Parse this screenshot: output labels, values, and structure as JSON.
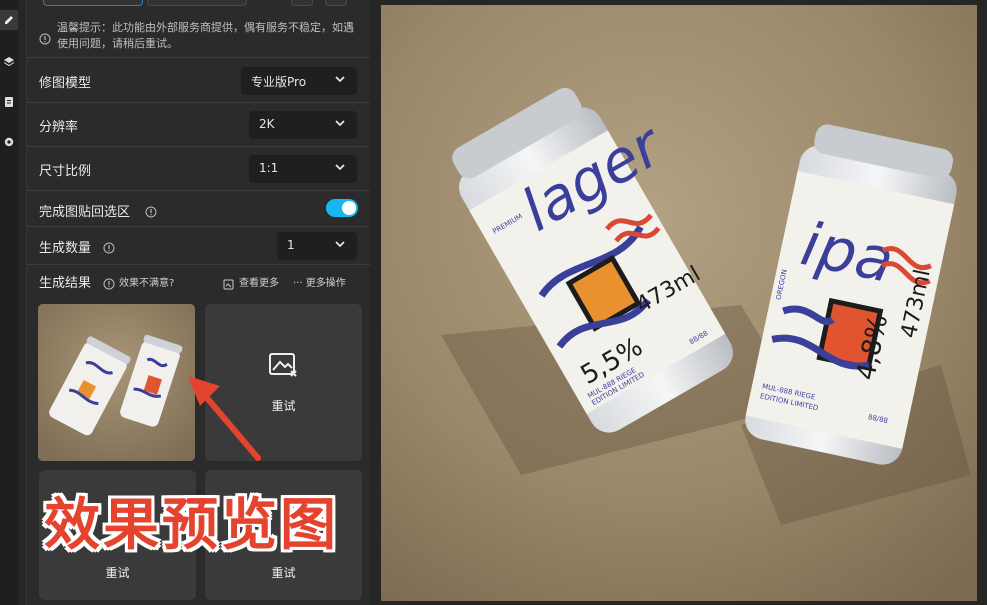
{
  "notice": {
    "text": "温馨提示：此功能由外部服务商提供，偶有服务不稳定，如遇使用问题，请稍后重试。"
  },
  "settings": {
    "model": {
      "label": "修图模型",
      "value": "专业版Pro"
    },
    "resolution": {
      "label": "分辨率",
      "value": "2K"
    },
    "ratio": {
      "label": "尺寸比例",
      "value": "1:1"
    },
    "paste_back": {
      "label": "完成图贴回选区",
      "on": true
    },
    "count": {
      "label": "生成数量",
      "value": "1"
    }
  },
  "results": {
    "label": "生成结果",
    "unsatisfied": "效果不满意?",
    "view_more": "查看更多",
    "more_actions": "··· 更多操作",
    "retry": "重试"
  },
  "overlay": {
    "caption": "效果预览图"
  },
  "cans": {
    "lager": {
      "name": "lager",
      "abv": "5,5%",
      "vol": "473ml",
      "small1": "PREMIUM",
      "small2": "MUL-888 RIEGE",
      "small3": "EDITION LIMITED",
      "small4": "88/88"
    },
    "ipa": {
      "name": "ipa",
      "abv": "4,8%",
      "vol": "473ml",
      "small1": "OREGON",
      "small2": "MUL-888 RIEGE",
      "small3": "EDITION LIMITED",
      "small4": "88/88"
    }
  },
  "colors": {
    "accent": "#19b6f0",
    "caption": "#e4432e",
    "panel": "#2b2b2b",
    "card": "#3a3a3a"
  }
}
